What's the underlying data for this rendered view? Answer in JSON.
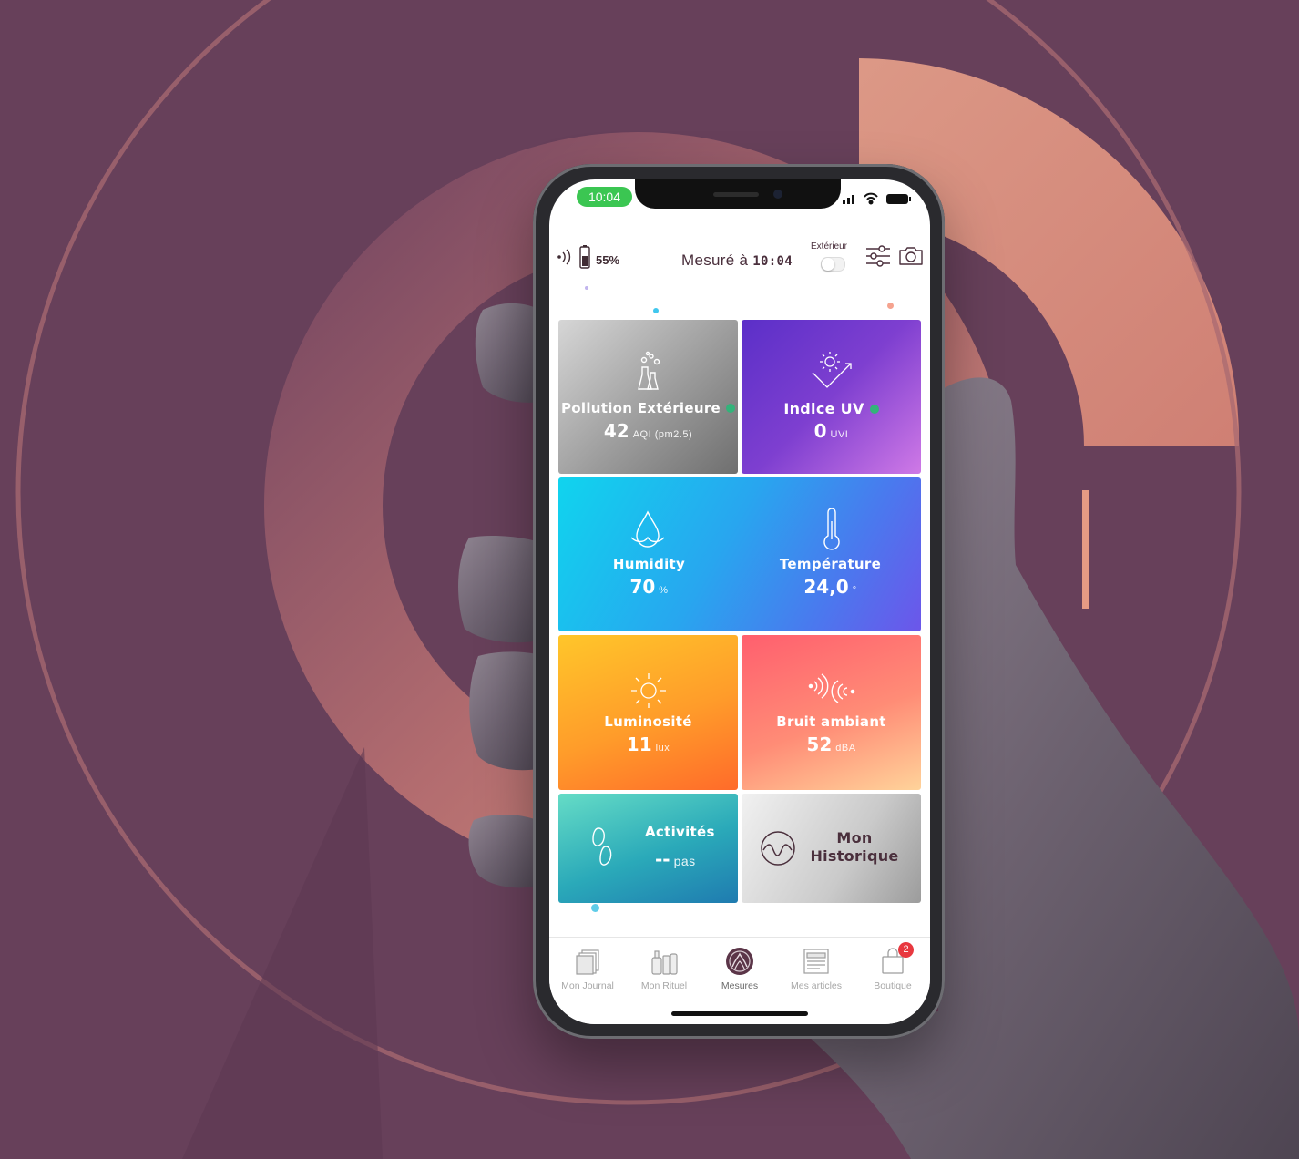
{
  "colors": {
    "background": "#67405a",
    "accent_ring": "#d08776",
    "status_dot": "#33b37a",
    "badge": "#e8383f",
    "time_pill": "#3bc652"
  },
  "status_bar": {
    "time": "10:04",
    "icons": [
      "cellular-signal-icon",
      "wifi-icon",
      "battery-icon"
    ]
  },
  "header": {
    "battery_level": "55%",
    "measured_prefix": "Mesuré à",
    "measured_time": "10:04",
    "exterior_label": "Extérieur",
    "exterior_toggle_on": false,
    "icons": [
      "device-signal-icon",
      "battery-icon",
      "filter-icon",
      "camera-icon"
    ]
  },
  "tiles": {
    "pollution": {
      "title": "Pollution Extérieure",
      "value": "42",
      "unit": "AQI (pm2.5)",
      "icon": "pollution-icon"
    },
    "uv": {
      "title": "Indice UV",
      "value": "0",
      "unit": "UVI",
      "icon": "sun-uv-icon"
    },
    "humidity": {
      "title": "Humidity",
      "value": "70",
      "unit": "%",
      "icon": "droplet-icon"
    },
    "temperature": {
      "title": "Température",
      "value": "24,0",
      "unit": "°",
      "icon": "thermometer-icon"
    },
    "luminosity": {
      "title": "Luminosité",
      "value": "11",
      "unit": "lux",
      "icon": "sun-icon"
    },
    "noise": {
      "title": "Bruit ambiant",
      "value": "52",
      "unit": "dBA",
      "icon": "sound-waves-icon"
    },
    "activities": {
      "title": "Activités",
      "value": "--",
      "unit": "pas",
      "icon": "footsteps-icon"
    },
    "history": {
      "title_line1": "Mon",
      "title_line2": "Historique",
      "icon": "history-wave-icon"
    }
  },
  "tabbar": {
    "items": [
      {
        "label": "Mon Journal",
        "icon": "journal-icon",
        "active": false
      },
      {
        "label": "Mon Rituel",
        "icon": "products-icon",
        "active": false
      },
      {
        "label": "Mesures",
        "icon": "measures-logo-icon",
        "active": true
      },
      {
        "label": "Mes articles",
        "icon": "articles-icon",
        "active": false
      },
      {
        "label": "Boutique",
        "icon": "shopping-bag-icon",
        "active": false,
        "badge": "2"
      }
    ]
  }
}
